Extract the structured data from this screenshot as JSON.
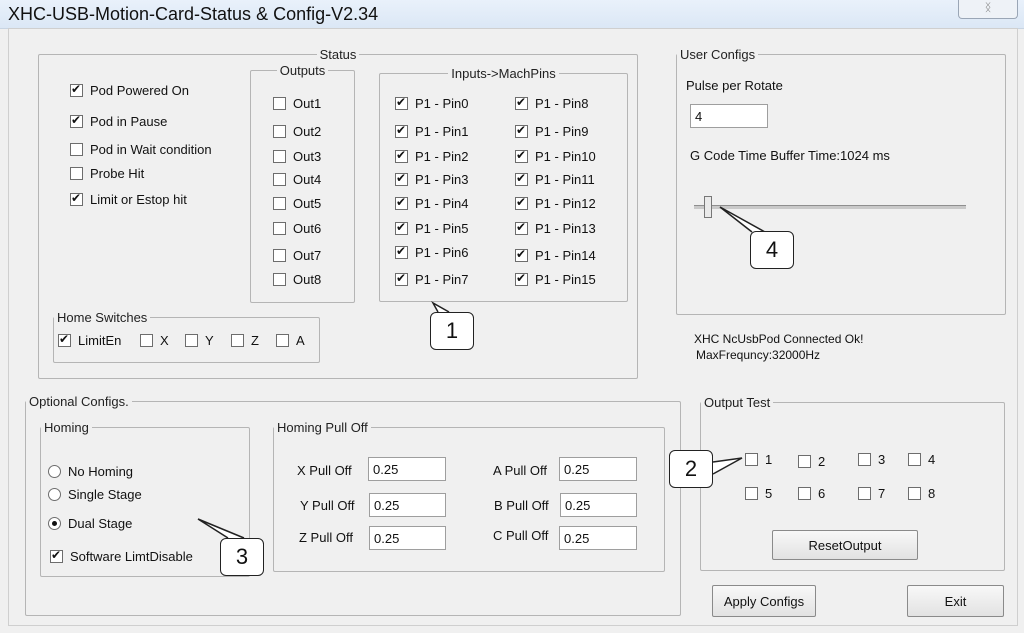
{
  "window": {
    "title": "XHC-USB-Motion-Card-Status & Config-V2.34",
    "close_glyph": "ᛝ"
  },
  "status": {
    "legend": "Status",
    "flags": [
      {
        "label": "Pod Powered On",
        "checked": true
      },
      {
        "label": "Pod in Pause",
        "checked": true
      },
      {
        "label": "Pod in Wait condition",
        "checked": false
      },
      {
        "label": "Probe Hit",
        "checked": false
      },
      {
        "label": "Limit or Estop hit",
        "checked": true
      }
    ],
    "outputs": {
      "legend": "Outputs",
      "items": [
        "Out1",
        "Out2",
        "Out3",
        "Out4",
        "Out5",
        "Out6",
        "Out7",
        "Out8"
      ]
    },
    "inputs": {
      "legend": "Inputs->MachPins",
      "col1": [
        "P1 - Pin0",
        "P1 - Pin1",
        "P1 - Pin2",
        "P1 - Pin3",
        "P1 - Pin4",
        "P1 - Pin5",
        "P1 - Pin6",
        "P1 - Pin7"
      ],
      "col2": [
        "P1 - Pin8",
        "P1 - Pin9",
        "P1 - Pin10",
        "P1 - Pin11",
        "P1 - Pin12",
        "P1 - Pin13",
        "P1 - Pin14",
        "P1 - Pin15"
      ]
    },
    "home_switches": {
      "legend": "Home Switches",
      "items": [
        {
          "label": "LimitEn",
          "checked": true
        },
        {
          "label": "X",
          "checked": false
        },
        {
          "label": "Y",
          "checked": false
        },
        {
          "label": "Z",
          "checked": false
        },
        {
          "label": "A",
          "checked": false
        }
      ]
    }
  },
  "user_configs": {
    "legend": "User Configs",
    "pulse_label": "Pulse per Rotate",
    "pulse_value": "4",
    "buffer_label": "G Code Time Buffer Time:1024 ms",
    "slider_level": 0.05
  },
  "connection": {
    "line1": "XHC NcUsbPod Connected Ok!",
    "line2": "MaxFrequncy:32000Hz"
  },
  "optional": {
    "legend": "Optional Configs.",
    "homing": {
      "legend": "Homing",
      "options": [
        {
          "label": "No Homing",
          "selected": false
        },
        {
          "label": "Single Stage",
          "selected": false
        },
        {
          "label": "Dual Stage",
          "selected": true
        }
      ],
      "software_limit": {
        "label": "Software LimtDisable",
        "checked": true
      }
    },
    "pull_off": {
      "legend": "Homing Pull Off",
      "x_label": "X Pull Off",
      "x_value": "0.25",
      "y_label": "Y Pull Off",
      "y_value": "0.25",
      "z_label": "Z Pull Off",
      "z_value": "0.25",
      "a_label": "A Pull Off",
      "a_value": "0.25",
      "b_label": "B Pull Off",
      "b_value": "0.25",
      "c_label": "C Pull Off",
      "c_value": "0.25"
    }
  },
  "output_test": {
    "legend": "Output Test",
    "items": [
      "1",
      "2",
      "3",
      "4",
      "5",
      "6",
      "7",
      "8"
    ],
    "reset_label": "ResetOutput"
  },
  "buttons": {
    "apply": "Apply Configs",
    "exit": "Exit"
  },
  "callouts": [
    "1",
    "2",
    "3",
    "4"
  ]
}
